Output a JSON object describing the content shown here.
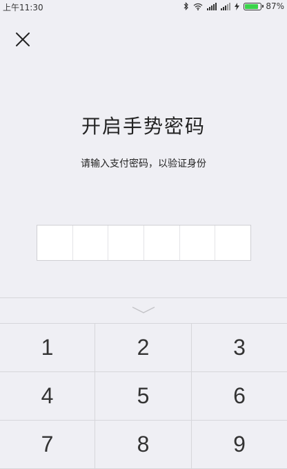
{
  "status_bar": {
    "time": "上午11:30",
    "battery_percent": "87%",
    "battery_level": 0.87,
    "battery_color": "#3ad34a"
  },
  "page": {
    "title": "开启手势密码",
    "subtitle": "请输入支付密码，以验证身份",
    "pin_length": 6
  },
  "keypad": {
    "keys": [
      "1",
      "2",
      "3",
      "4",
      "5",
      "6",
      "7",
      "8",
      "9"
    ]
  },
  "icons": {
    "close": "close-icon",
    "collapse": "chevron-down-icon"
  }
}
